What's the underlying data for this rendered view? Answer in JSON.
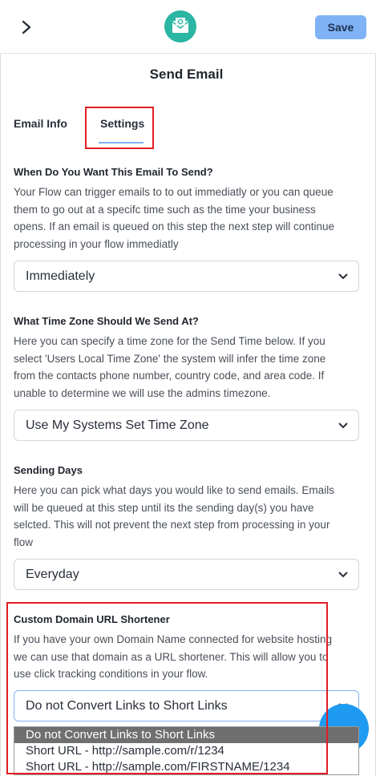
{
  "header": {
    "back_icon": "chevron-right-icon",
    "logo_icon": "email-envelope-icon",
    "save_label": "Save",
    "accent": "#7fb3f5",
    "logo_color": "#2bb5a3"
  },
  "page_title": "Send Email",
  "tabs": [
    {
      "label": "Email Info",
      "active": false
    },
    {
      "label": "Settings",
      "active": true
    }
  ],
  "sections": {
    "send_time": {
      "heading": "When Do You Want This Email To Send?",
      "lines": [
        "Your Flow can trigger emails to to out immediatly or you can queue",
        "them to go out at a specifc time such as the time your business",
        "opens. If an email is queued on this step the next step will continue",
        "processing in your flow immediatly"
      ],
      "value": "Immediately"
    },
    "time_zone": {
      "heading": "What Time Zone Should We Send At?",
      "lines": [
        "Here you can specify a time zone for the Send Time below. If you",
        "select 'Users Local Time Zone' the system will infer the time zone",
        "from the contacts phone number, country code, and area code. If",
        "unable to determine we will use the admins timezone."
      ],
      "value": "Use My Systems Set Time Zone"
    },
    "sending_days": {
      "heading": "Sending Days",
      "lines": [
        "Here you can pick what days you would like to send emails. Emails",
        "will be queued at this step until its the sending day(s) you have",
        "selcted. This will not prevent the next step from processing in your",
        "flow"
      ],
      "value": "Everyday"
    },
    "url_shortener": {
      "heading": "Custom Domain URL Shortener",
      "lines": [
        "If you have your own Domain Name connected for website hosting",
        "we can use that domain as a URL shortener. This will allow you to",
        "use click tracking conditions in your flow."
      ],
      "value": "Do not Convert Links to Short Links",
      "options": [
        "Do not Convert Links to Short Links",
        "Short URL - http://sample.com/r/1234",
        "Short URL - http://sample.com/FIRSTNAME/1234"
      ]
    }
  },
  "highlight_color": "#e01e24"
}
